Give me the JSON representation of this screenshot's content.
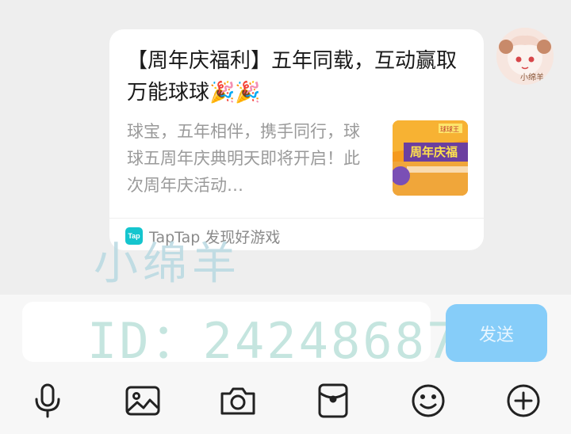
{
  "card": {
    "title": "【周年庆福利】五年同载，互动赢取万能球球🎉🎉",
    "description": "球宝，五年相伴，携手同行，球球五周年庆典明天即将开启！此次周年庆活动…",
    "thumbnail_text": "周年庆福",
    "thumbnail_small_text": "球球王",
    "footer_logo": "Tap",
    "footer_text": "TapTap 发现好游戏"
  },
  "avatar": {
    "text": "小绵羊"
  },
  "watermark": {
    "name": "小绵羊",
    "id": "ID：24248687"
  },
  "input": {
    "value": ""
  },
  "send_button": {
    "label": "发送"
  },
  "toolbar": {
    "icons": [
      "microphone-icon",
      "image-icon",
      "camera-icon",
      "red-packet-icon",
      "emoji-icon",
      "plus-icon"
    ]
  },
  "colors": {
    "send_button": "#86cdf9",
    "tap_logo": "#15c5ce",
    "thumbnail_orange": "#f59a1e",
    "thumbnail_purple": "#6b3fa0"
  }
}
